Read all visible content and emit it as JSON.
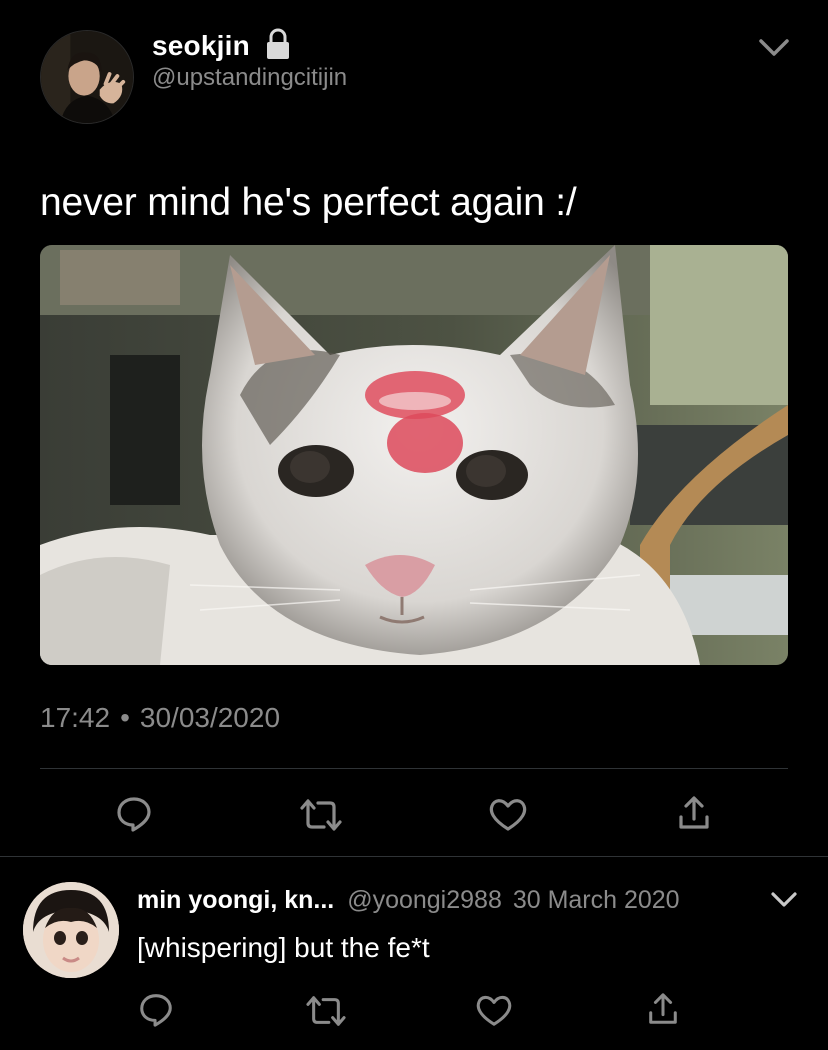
{
  "tweet": {
    "display_name": "seokjin",
    "handle": "@upstandingcitijin",
    "protected_icon": "lock-icon",
    "menu_icon": "chevron-down-icon",
    "text": "never mind he's perfect again :/",
    "media_description_icon": "photo",
    "time": "17:42",
    "separator": "•",
    "date": "30/03/2020",
    "actions": {
      "reply_icon": "reply-icon",
      "retweet_icon": "retweet-icon",
      "like_icon": "heart-icon",
      "share_icon": "share-icon"
    }
  },
  "reply": {
    "display_name": "min yoongi, kn...",
    "handle": "@yoongi2988",
    "date": "30 March 2020",
    "text": "[whispering] but the fe*t",
    "menu_icon": "chevron-down-icon",
    "actions": {
      "reply_icon": "reply-icon",
      "retweet_icon": "retweet-icon",
      "like_icon": "heart-icon",
      "share_icon": "share-icon"
    }
  },
  "colors": {
    "background": "#000000",
    "text_primary": "#ffffff",
    "text_secondary": "#8b8b8b",
    "divider": "#2f3336",
    "icon": "#8b8b8b"
  }
}
